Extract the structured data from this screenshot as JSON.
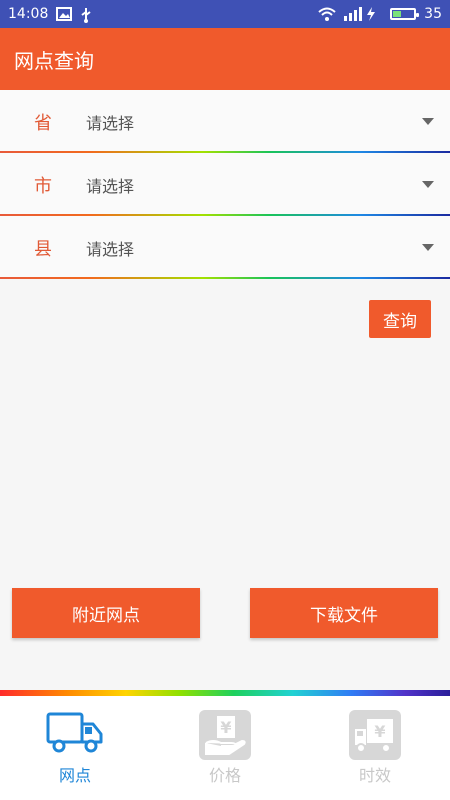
{
  "status_bar": {
    "time": "14:08",
    "battery": "35",
    "colors": {
      "background": "#3f51b5"
    }
  },
  "app_bar": {
    "title": "网点查询",
    "color": "#f05a2c"
  },
  "form": {
    "rows": [
      {
        "label": "省",
        "value": "请选择"
      },
      {
        "label": "市",
        "value": "请选择"
      },
      {
        "label": "县",
        "value": "请选择"
      }
    ]
  },
  "buttons": {
    "query": "查询",
    "nearby": "附近网点",
    "download": "下载文件"
  },
  "bottom_nav": {
    "items": [
      {
        "label": "网点",
        "icon": "truck-icon",
        "active": true
      },
      {
        "label": "价格",
        "icon": "price-hand-icon",
        "active": false
      },
      {
        "label": "时效",
        "icon": "delivery-time-icon",
        "active": false
      }
    ],
    "active_color": "#1f86d7",
    "inactive_color": "#c8c8c8"
  }
}
